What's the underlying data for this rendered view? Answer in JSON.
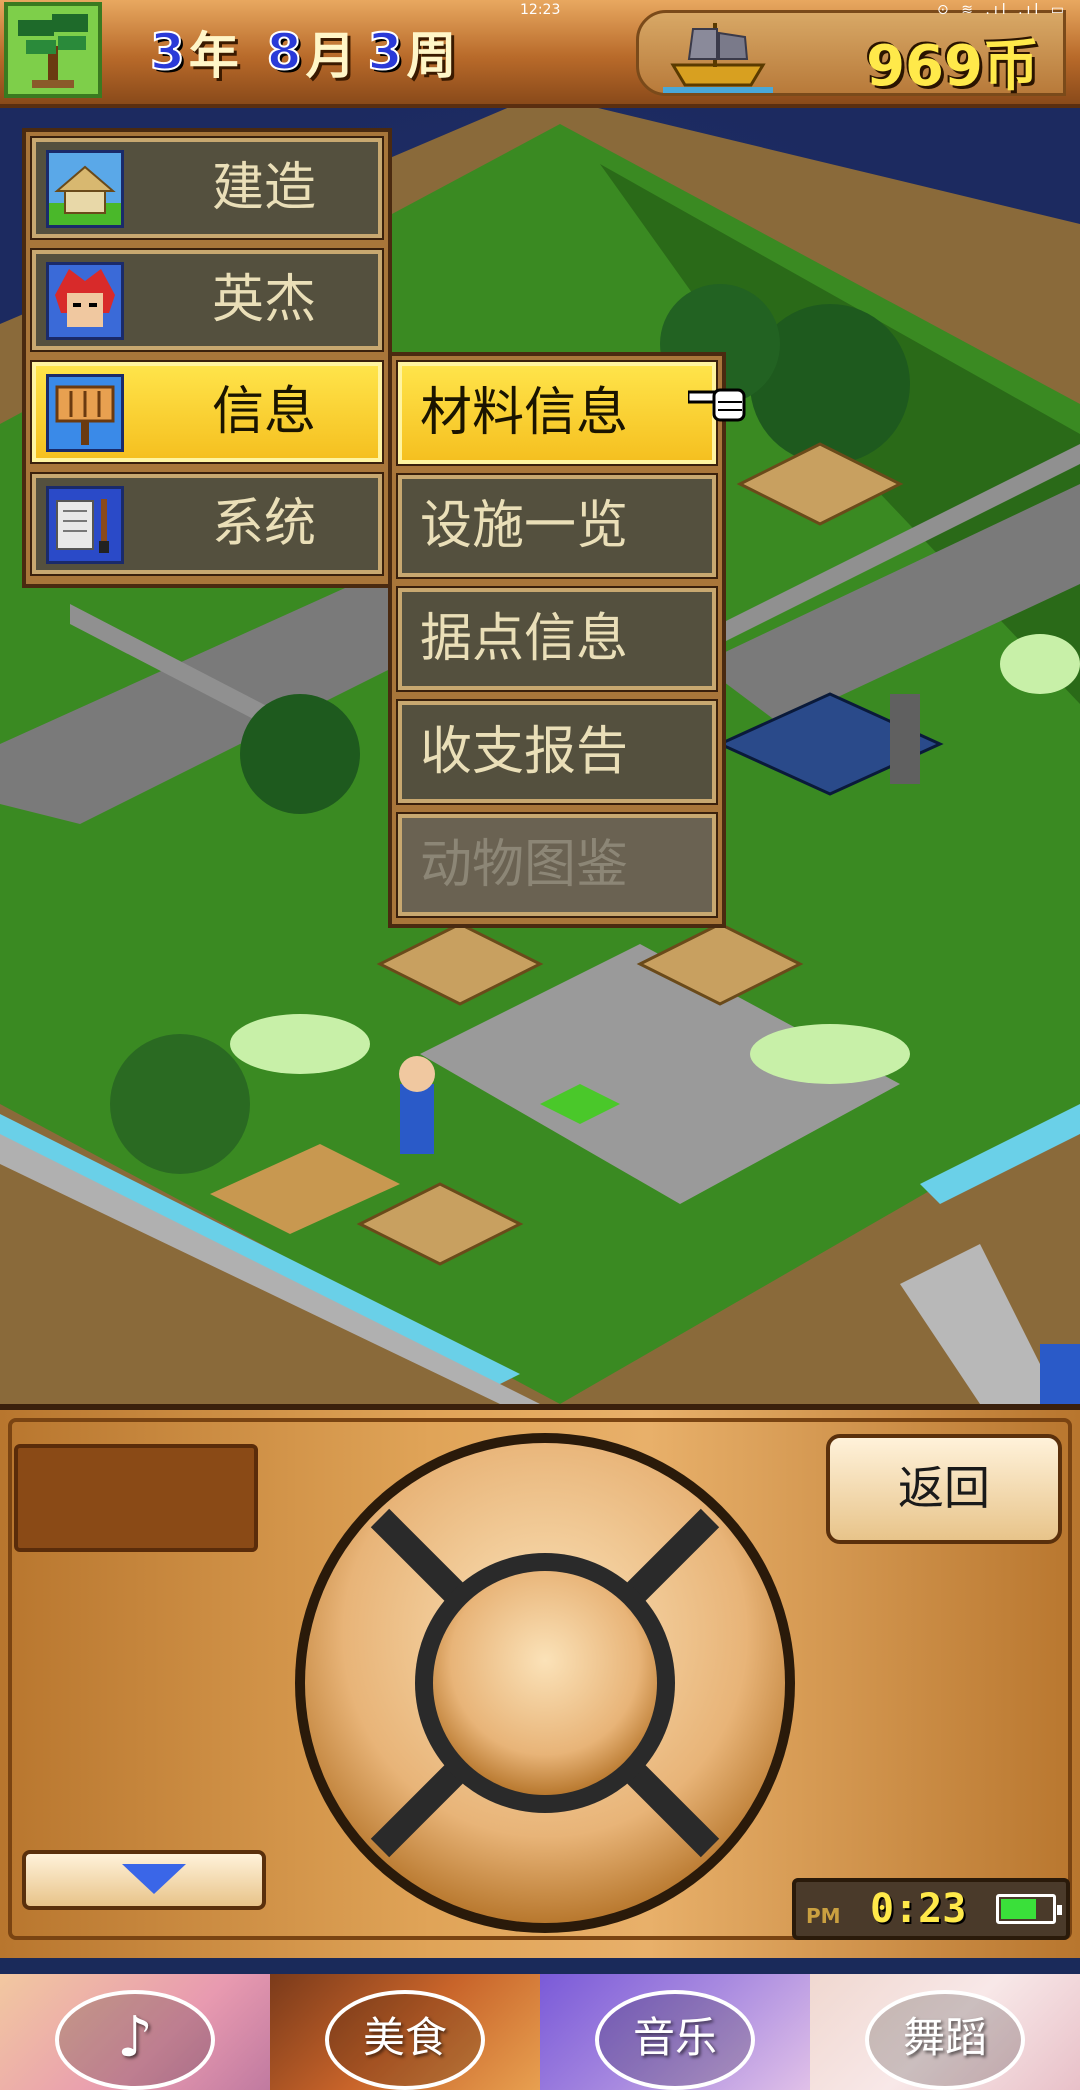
{
  "status_bar": {
    "time": "12:23",
    "icons": "⊙ ≋ .ıl .ıl ▭"
  },
  "top_bar": {
    "year_num": "3",
    "year_unit": "年",
    "month_num": "8",
    "month_unit": "月",
    "week_num": "3",
    "week_unit": "周",
    "coins": "969币"
  },
  "main_menu": {
    "items": [
      {
        "label": "建造",
        "icon": "house-icon",
        "active": false
      },
      {
        "label": "英杰",
        "icon": "hero-portrait-icon",
        "active": false
      },
      {
        "label": "信息",
        "icon": "notice-board-icon",
        "active": true
      },
      {
        "label": "系统",
        "icon": "scroll-brush-icon",
        "active": false
      }
    ]
  },
  "sub_menu": {
    "items": [
      {
        "label": "材料信息",
        "state": "active"
      },
      {
        "label": "设施一览",
        "state": "normal"
      },
      {
        "label": "据点信息",
        "state": "normal"
      },
      {
        "label": "收支报告",
        "state": "normal"
      },
      {
        "label": "动物图鉴",
        "state": "disabled"
      }
    ]
  },
  "controller": {
    "back_label": "返回",
    "clock_ampm": "PM",
    "clock_time": "0:23",
    "battery_level": 0.7
  },
  "ads": [
    {
      "label": "♪",
      "icon": "tiktok-icon"
    },
    {
      "label": "美食"
    },
    {
      "label": "音乐"
    },
    {
      "label": "舞蹈"
    }
  ],
  "colors": {
    "menu_active": "#f5c020",
    "menu_normal": "#54503e",
    "coin_text": "#ffe94a",
    "date_num": "#2a3ad8"
  }
}
